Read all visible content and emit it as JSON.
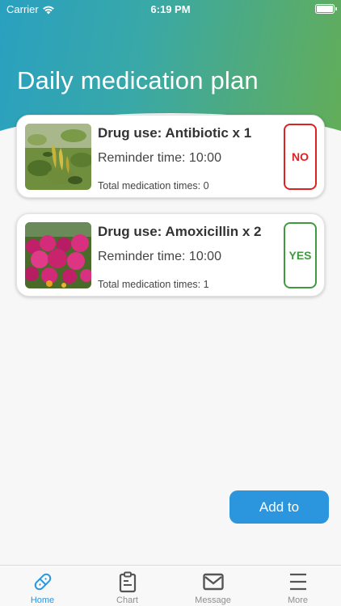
{
  "status_bar": {
    "carrier": "Carrier",
    "time": "6:19 PM"
  },
  "header": {
    "title": "Daily medication plan"
  },
  "plans": [
    {
      "drug_label": "Drug use: Antibiotic x 1",
      "reminder_label": "Reminder time: 10:00",
      "total_label": "Total medication times: 0",
      "status": "NO"
    },
    {
      "drug_label": "Drug use: Amoxicillin x 2",
      "reminder_label": "Reminder time: 10:00",
      "total_label": "Total medication times: 1",
      "status": "YES"
    }
  ],
  "add_button": {
    "label": "Add to"
  },
  "tabbar": {
    "items": [
      {
        "label": "Home",
        "icon": "pill-icon",
        "active": true
      },
      {
        "label": "Chart",
        "icon": "clipboard-icon",
        "active": false
      },
      {
        "label": "Message",
        "icon": "envelope-icon",
        "active": false
      },
      {
        "label": "More",
        "icon": "menu-icon",
        "active": false
      }
    ]
  },
  "colors": {
    "accent": "#2b96de",
    "no": "#dd2222",
    "yes": "#3f9a3f"
  }
}
